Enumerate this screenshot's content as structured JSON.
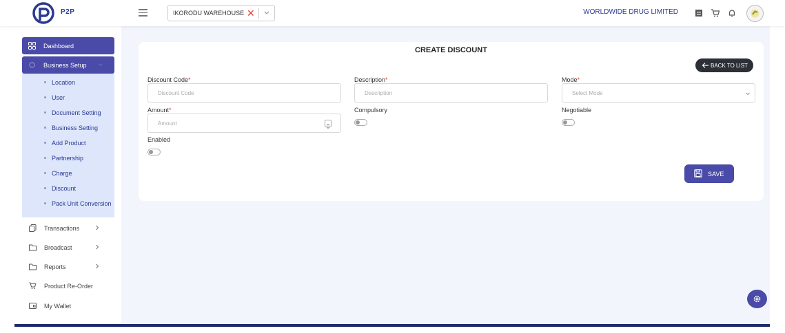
{
  "header": {
    "logo_text": "P2P",
    "warehouse_selected": "IKORODU WAREHOUSE",
    "warehouse_clear_glyph": "✕",
    "company_name": "WORLDWIDE DRUG LIMITED",
    "accent_color": "#4a4aa8",
    "brand_color": "#2a3a8f"
  },
  "sidebar": {
    "dashboard_label": "Dashboard",
    "business_setup_label": "Business Setup",
    "sub_items": [
      {
        "label": "Location"
      },
      {
        "label": "User"
      },
      {
        "label": "Document Setting"
      },
      {
        "label": "Business Setting"
      },
      {
        "label": "Add Product"
      },
      {
        "label": "Partnership"
      },
      {
        "label": "Charge"
      },
      {
        "label": "Discount"
      },
      {
        "label": "Pack Unit Conversion"
      }
    ],
    "items": [
      {
        "label": "Transactions",
        "icon": "copy-icon",
        "chevron": true
      },
      {
        "label": "Broadcast",
        "icon": "folder-icon",
        "chevron": true
      },
      {
        "label": "Reports",
        "icon": "folder-icon",
        "chevron": true
      },
      {
        "label": "Product Re-Order",
        "icon": "cart-icon",
        "chevron": false
      },
      {
        "label": "My Wallet",
        "icon": "wallet-icon",
        "chevron": false
      }
    ]
  },
  "form": {
    "title": "CREATE DISCOUNT",
    "back_label": "BACK TO LIST",
    "discount_code_label": "Discount Code",
    "discount_code_placeholder": "Discount Code",
    "description_label": "Description",
    "description_placeholder": "Description",
    "mode_label": "Mode",
    "mode_placeholder": "Select Mode",
    "amount_label": "Amount",
    "amount_placeholder": "Amount",
    "compulsory_label": "Compulsory",
    "negotiable_label": "Negotiable",
    "enabled_label": "Enabled",
    "required_mark": "*",
    "save_label": "SAVE"
  }
}
